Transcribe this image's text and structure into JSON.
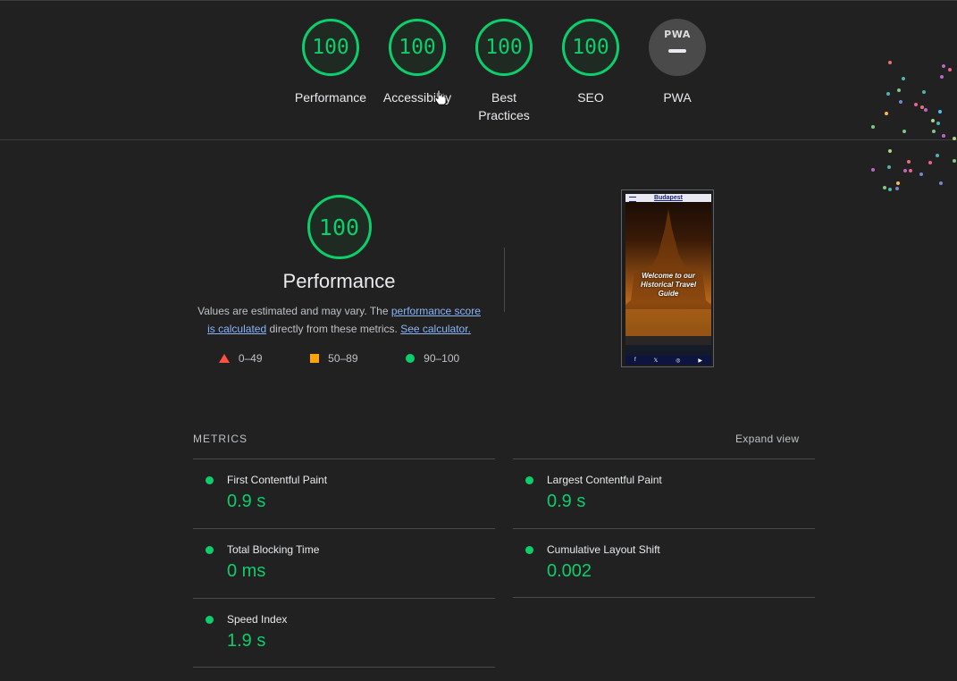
{
  "summary": {
    "gauges": [
      {
        "score": "100",
        "label": "Performance"
      },
      {
        "score": "100",
        "label": "Accessibility"
      },
      {
        "score": "100",
        "label": "Best Practices"
      },
      {
        "score": "100",
        "label": "SEO"
      }
    ],
    "pwa": {
      "badge": "PWA",
      "label": "PWA"
    }
  },
  "performance": {
    "score": "100",
    "title": "Performance",
    "desc_prefix": "Values are estimated and may vary. The ",
    "desc_link1": "performance score is calculated",
    "desc_middle": " directly from these metrics. ",
    "desc_link2": "See calculator.",
    "legend": [
      {
        "range": "0–49",
        "color": "#ff4e42"
      },
      {
        "range": "50–89",
        "color": "#ffa400"
      },
      {
        "range": "90–100",
        "color": "#0cce6b"
      }
    ]
  },
  "screenshot": {
    "header_title": "Budapest",
    "caption": "Welcome to our Historical Travel Guide",
    "footer_icons": [
      "f",
      "𝕏",
      "◎",
      "▶"
    ]
  },
  "metrics": {
    "heading": "METRICS",
    "expand_label": "Expand view",
    "items": [
      {
        "name": "First Contentful Paint",
        "value": "0.9 s"
      },
      {
        "name": "Largest Contentful Paint",
        "value": "0.9 s"
      },
      {
        "name": "Total Blocking Time",
        "value": "0 ms"
      },
      {
        "name": "Cumulative Layout Shift",
        "value": "0.002"
      },
      {
        "name": "Speed Index",
        "value": "1.9 s"
      }
    ]
  },
  "colors": {
    "pass": "#0cce6b",
    "average": "#ffa400",
    "fail": "#ff4e42",
    "background": "#212121"
  }
}
